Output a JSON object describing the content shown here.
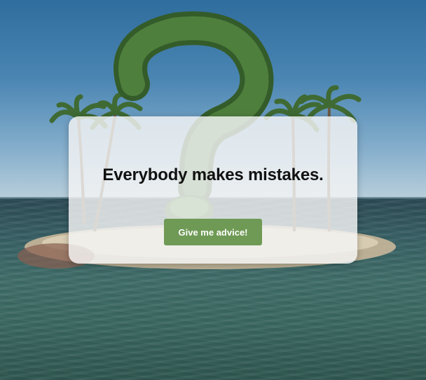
{
  "card": {
    "title": "Everybody makes mistakes.",
    "button_label": "Give me advice!"
  },
  "background": {
    "icon": "question-mark-topiary-island",
    "colors": {
      "sky": "#3b78a8",
      "sea": "#3a6660",
      "foliage": "#3f6a33"
    }
  },
  "colors": {
    "button": "#6f9a55",
    "button_text": "#ffffff",
    "card": "#f5f5f5",
    "title": "#111111"
  }
}
